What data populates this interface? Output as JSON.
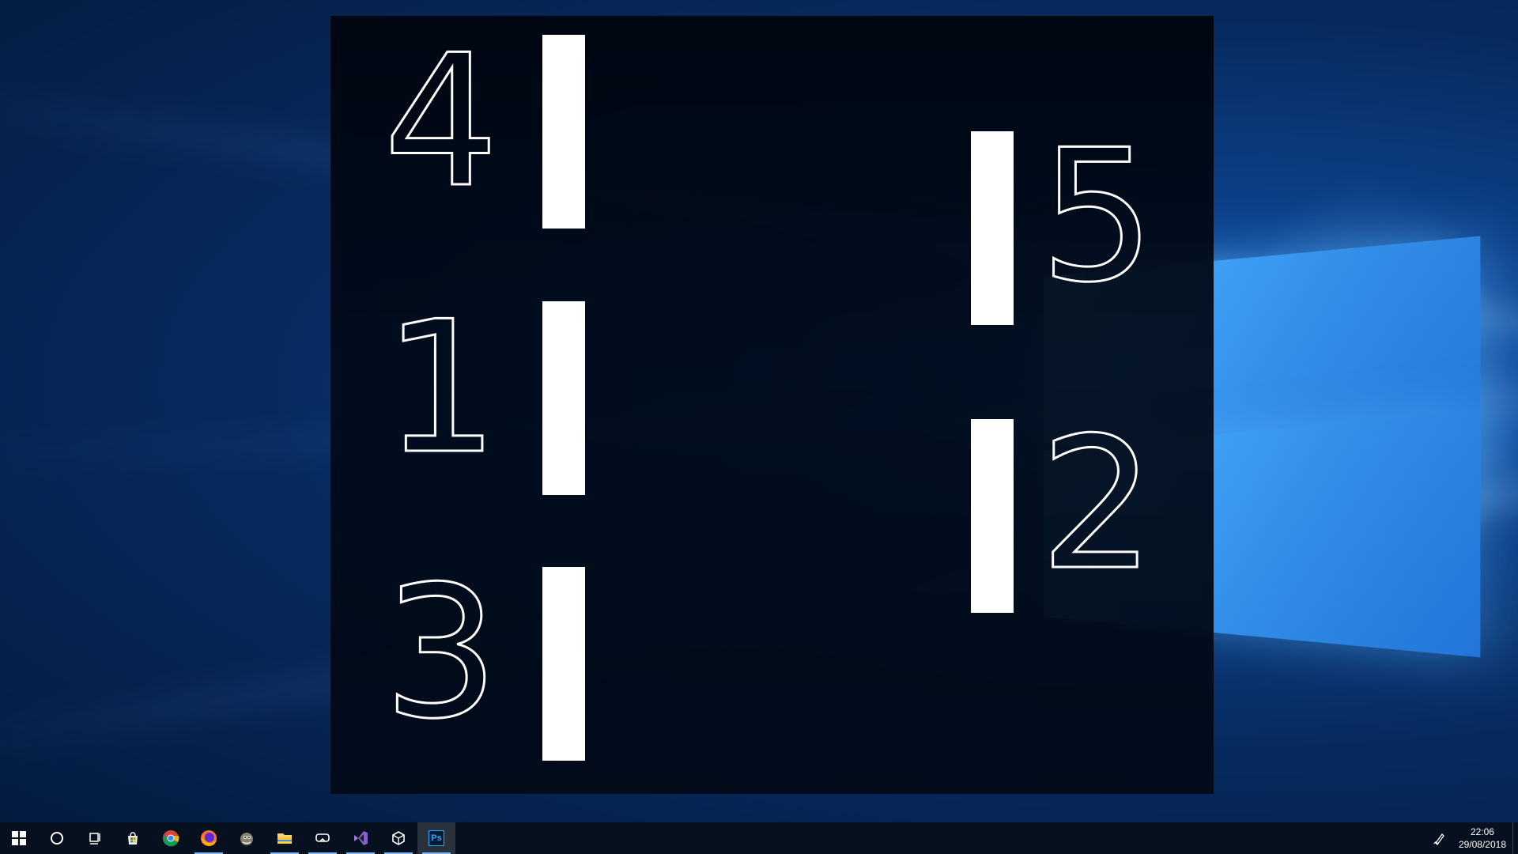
{
  "zones": [
    {
      "number": "4"
    },
    {
      "number": "1"
    },
    {
      "number": "3"
    },
    {
      "number": "5"
    },
    {
      "number": "2"
    }
  ],
  "taskbar": {
    "apps": [
      {
        "icon": "windows-start-icon"
      },
      {
        "icon": "cortana-search-icon"
      },
      {
        "icon": "task-view-icon"
      },
      {
        "icon": "store-icon"
      },
      {
        "icon": "chrome-icon"
      },
      {
        "icon": "firefox-icon"
      },
      {
        "icon": "gimp-icon"
      },
      {
        "icon": "file-explorer-icon"
      },
      {
        "icon": "vr-headset-icon"
      },
      {
        "icon": "visual-studio-icon"
      },
      {
        "icon": "unity-icon"
      },
      {
        "icon": "photoshop-icon",
        "label": "Ps"
      }
    ],
    "clock": {
      "time": "22:06",
      "date": "29/08/2018"
    },
    "tray_icon": "pen-ink-icon"
  },
  "colors": {
    "accent": "#0078d7",
    "taskbar": "#06101e",
    "overlay": "#010a18"
  }
}
